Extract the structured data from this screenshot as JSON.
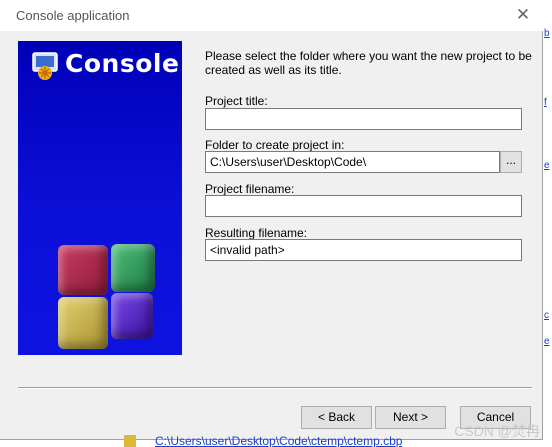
{
  "window": {
    "title": "Console application",
    "close_glyph": "✕"
  },
  "banner": {
    "brand": "Console",
    "icon": "console-app-icon",
    "colors": {
      "background": "#0a0ad0",
      "cube_red": "#b0244a",
      "cube_green": "#2f9a5a",
      "cube_yellow": "#c8b44a",
      "cube_purple": "#5020c0"
    }
  },
  "form": {
    "intro": "Please select the folder where you want the new project to be created as well as its title.",
    "project_title": {
      "label": "Project title:",
      "value": ""
    },
    "folder": {
      "label": "Folder to create project in:",
      "value": "C:\\Users\\user\\Desktop\\Code\\",
      "browse_label": "..."
    },
    "project_filename": {
      "label": "Project filename:",
      "value": ""
    },
    "resulting_filename": {
      "label": "Resulting filename:",
      "value": "<invalid path>"
    }
  },
  "buttons": {
    "back": "< Back",
    "next": "Next >",
    "cancel": "Cancel"
  },
  "background": {
    "right_fragments": [
      "b",
      "f",
      "e",
      "c",
      "e"
    ],
    "bottom_path": "C:\\Users\\user\\Desktop\\Code\\ctemp\\ctemp.cbp",
    "watermark": "CSDN @焚冉"
  }
}
